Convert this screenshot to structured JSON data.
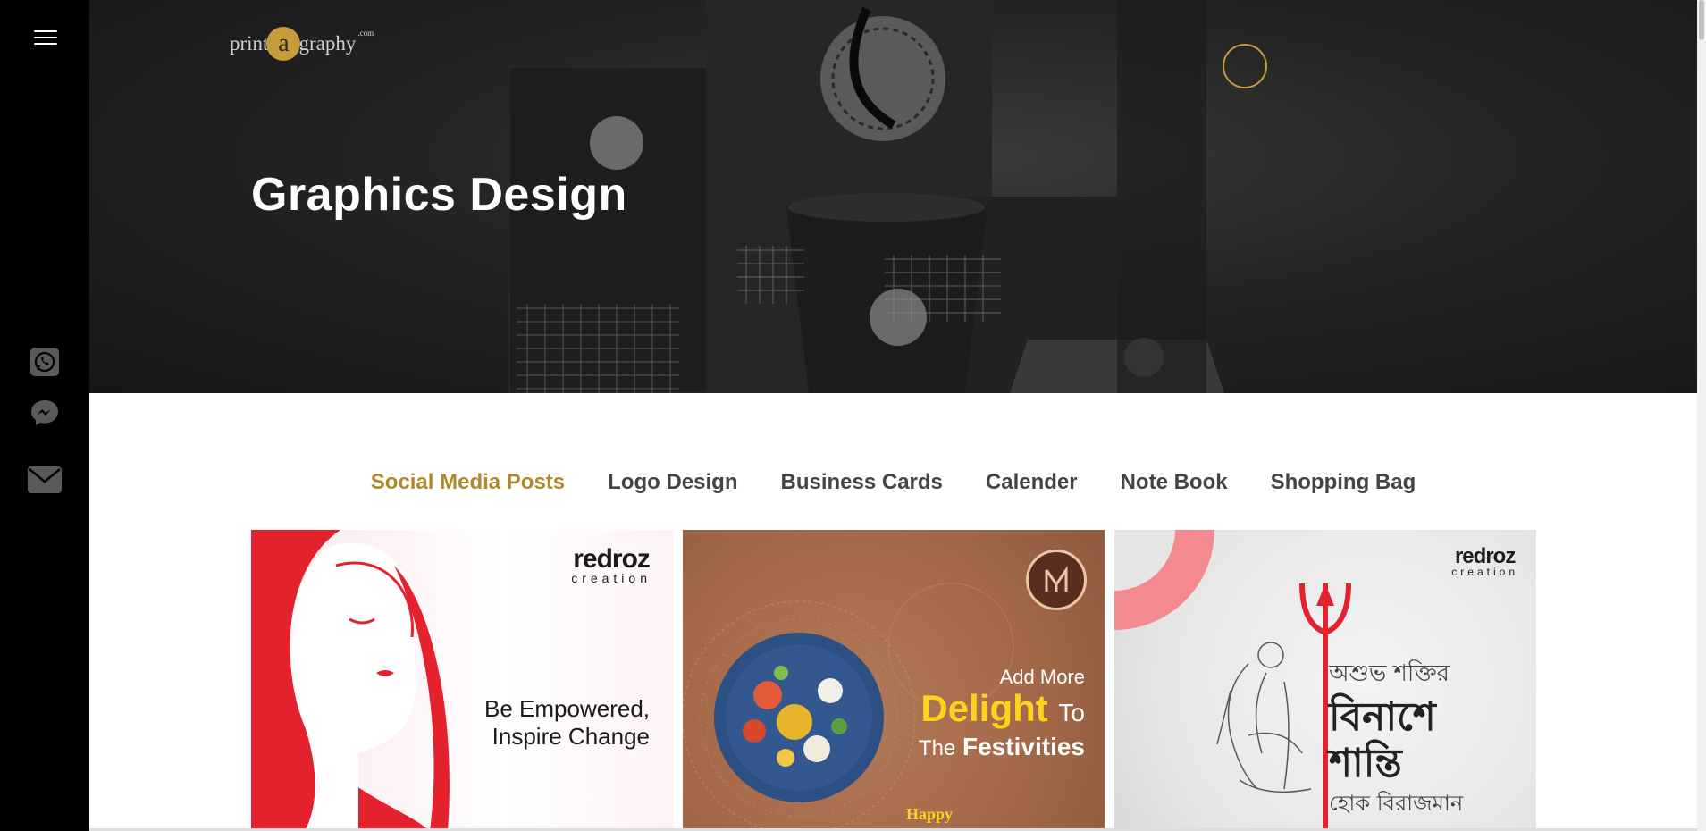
{
  "nav": {
    "menu_icon": "hamburger-menu-icon",
    "social_icons": [
      "whatsapp-icon",
      "messenger-icon",
      "email-icon"
    ]
  },
  "logo": {
    "pre": "print",
    "letter": "a",
    "post": "graphy",
    "suffix": ".com"
  },
  "hero": {
    "title": "Graphics Design"
  },
  "tabs": [
    {
      "label": "Social Media Posts",
      "active": true
    },
    {
      "label": "Logo Design",
      "active": false
    },
    {
      "label": "Business Cards",
      "active": false
    },
    {
      "label": "Calender",
      "active": false
    },
    {
      "label": "Note Book",
      "active": false
    },
    {
      "label": "Shopping Bag",
      "active": false
    }
  ],
  "cards": [
    {
      "brand": "redroz",
      "brand_sub": "creation",
      "line1": "Be Empowered,",
      "line2": "Inspire Change"
    },
    {
      "pre": "Add More",
      "big": "Delight",
      "to": "To",
      "the": "The",
      "fest": "Festivities",
      "happy": "Happy"
    },
    {
      "brand": "redroz",
      "brand_sub": "creation",
      "bn1": "অশুভ শক্তির",
      "bn2": "বিনাশে",
      "bn3": "শান্তি",
      "bn4": "হোক বিরাজমান"
    }
  ],
  "colors": {
    "accent": "#b0892f",
    "gold": "#c69b3a",
    "sidebar": "#000000",
    "card1_red": "#e4222e",
    "card2_tan": "#a4694a",
    "card2_yellow": "#ffd21c"
  }
}
